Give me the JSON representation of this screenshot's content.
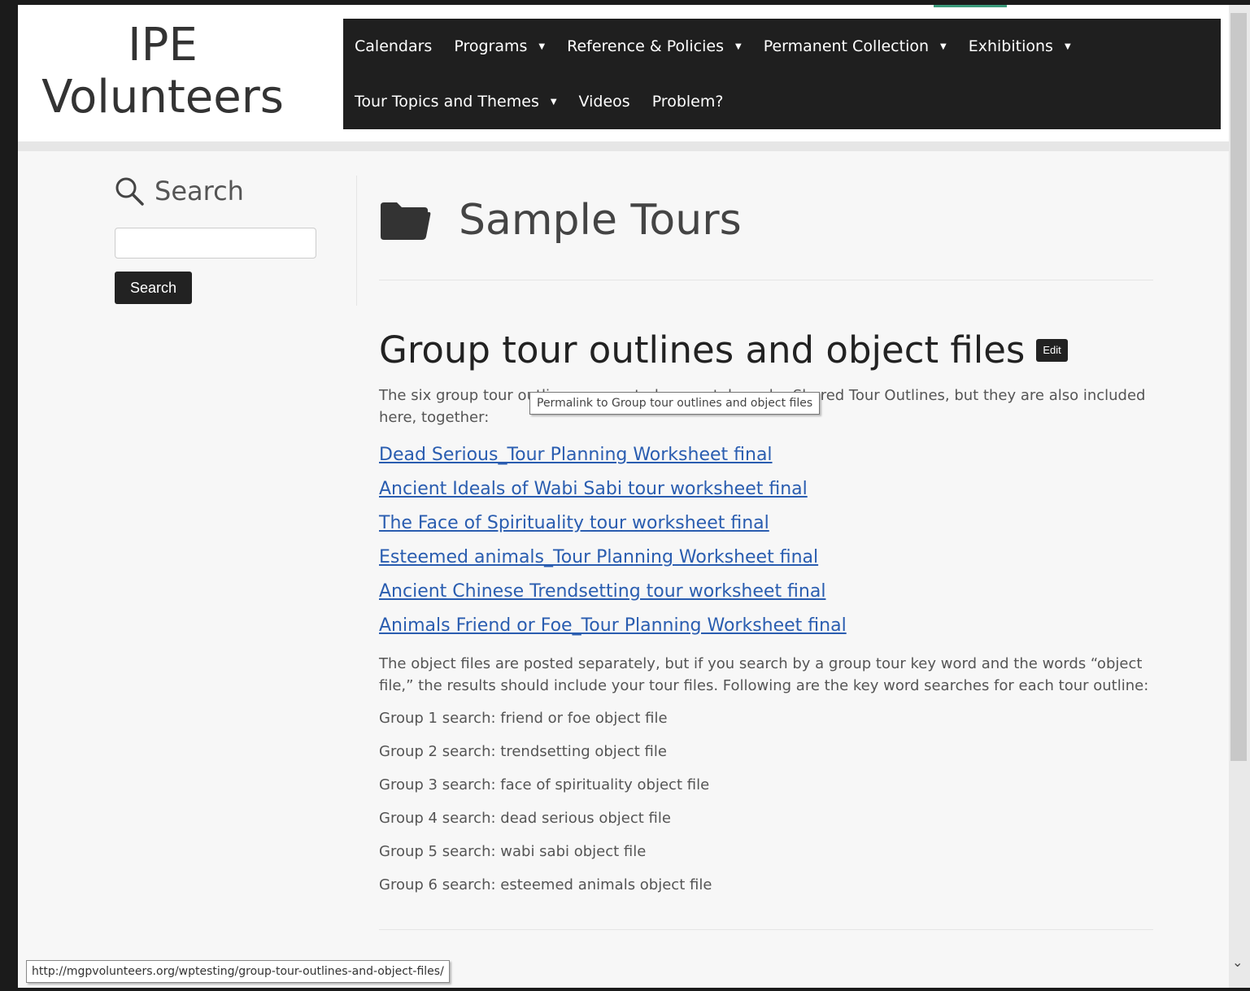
{
  "site": {
    "title_line1": "IPE",
    "title_line2": "Volunteers"
  },
  "nav": {
    "row1": [
      {
        "label": "Calendars",
        "caret": false
      },
      {
        "label": "Programs",
        "caret": true
      },
      {
        "label": "Reference & Policies",
        "caret": true
      },
      {
        "label": "Permanent Collection",
        "caret": true
      },
      {
        "label": "Exhibitions",
        "caret": true
      }
    ],
    "row2": [
      {
        "label": "Tour Topics and Themes",
        "caret": true
      },
      {
        "label": "Videos",
        "caret": false
      },
      {
        "label": "Problem?",
        "caret": false
      }
    ],
    "caret_glyph": "▼"
  },
  "sidebar": {
    "search_heading": "Search",
    "search_placeholder": "",
    "search_button": "Search"
  },
  "page": {
    "title": "Sample Tours",
    "icon": "folder-icon"
  },
  "post": {
    "title": "Group tour outlines and object files",
    "edit_label": "Edit",
    "intro": "The six group tour outlines are posted separately under Shared Tour Outlines, but they are also included here, together:",
    "links": [
      "Dead Serious_Tour Planning Worksheet final",
      "Ancient Ideals of Wabi Sabi tour worksheet final",
      "The Face of Spirituality tour worksheet final",
      "Esteemed animals_Tour Planning Worksheet final",
      "Ancient Chinese Trendsetting tour worksheet final",
      "Animals Friend or Foe_Tour Planning Worksheet final"
    ],
    "object_files_note": "The object files are posted separately, but if you search by a group tour key word and the words “object file,” the results should include your tour files. Following are the key word searches for each tour outline:",
    "group_searches": [
      "Group 1 search: friend or foe object file",
      "Group 2 search: trendsetting object file",
      "Group 3 search: face of spirituality object file",
      "Group 4 search: dead serious object file",
      "Group 5 search: wabi sabi object file",
      "Group 6 search: esteemed animals object file"
    ]
  },
  "tooltip": "Permalink to Group tour outlines and object files",
  "status_url": "http://mgpvolunteers.org/wptesting/group-tour-outlines-and-object-files/",
  "colors": {
    "nav_bg": "#1f1f1f",
    "link": "#2a5db0",
    "accent": "#3a9a7a"
  }
}
